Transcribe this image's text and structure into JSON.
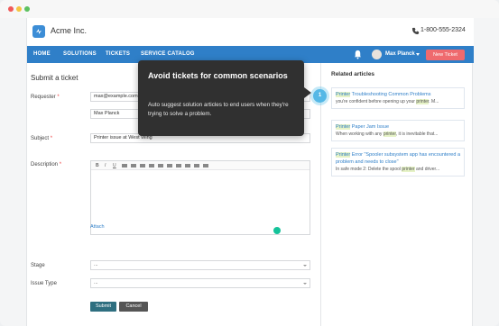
{
  "brand": {
    "name": "Acme Inc.",
    "phone": "1-800-555-2324"
  },
  "nav": {
    "items": [
      "HOME",
      "SOLUTIONS",
      "TICKETS",
      "SERVICE CATALOG"
    ],
    "user": "Max Planck",
    "new_ticket": "New Ticket"
  },
  "form": {
    "title": "Submit a ticket",
    "requester_label": "Requester",
    "requester_email": "max@example.com",
    "requester_name": "Max Planck",
    "subject_label": "Subject",
    "subject_value": "Printer issue at West Wing",
    "description_label": "Description",
    "toolbar": [
      "B",
      "I",
      "U"
    ],
    "attach": "Attach",
    "stage_label": "Stage",
    "stage_value": "...",
    "issue_type_label": "Issue Type",
    "issue_type_value": "...",
    "required_mark": "*",
    "submit": "Submit",
    "cancel": "Cancel"
  },
  "related": {
    "title": "Related articles",
    "articles": [
      {
        "keyword": "Printer",
        "title_rest": "Troubleshooting Common Problems",
        "body_pre": "you're confident before opening up your ",
        "body_kw": "printer",
        "body_post": ". M..."
      },
      {
        "keyword": "Printer",
        "title_rest": "Paper Jam Issue",
        "body_pre": "When working with any ",
        "body_kw": "printer",
        "body_post": ", it is inevitable that..."
      },
      {
        "keyword": "Printer",
        "title_rest": "Error \"Spooler subsystem app has encountered a problem and needs to close\"",
        "body_pre": "In safe mode 2: Delete the spool ",
        "body_kw": "printer",
        "body_post": " and driver..."
      }
    ]
  },
  "tooltip": {
    "title": "Avoid tickets for common scenarios",
    "body": "Auto suggest solution articles to end users when they're trying to solve a problem.",
    "step": "1"
  },
  "colors": {
    "nav": "#2f7fc8",
    "new_ticket": "#ef6a6e",
    "submit": "#2e6f80",
    "tooltip": "#303030",
    "step": "#55b8e6"
  },
  "icons": [
    "acme-logo-icon",
    "phone-icon",
    "bell-icon",
    "user-avatar-icon",
    "dropdown-caret-icon",
    "grammarly-icon"
  ]
}
